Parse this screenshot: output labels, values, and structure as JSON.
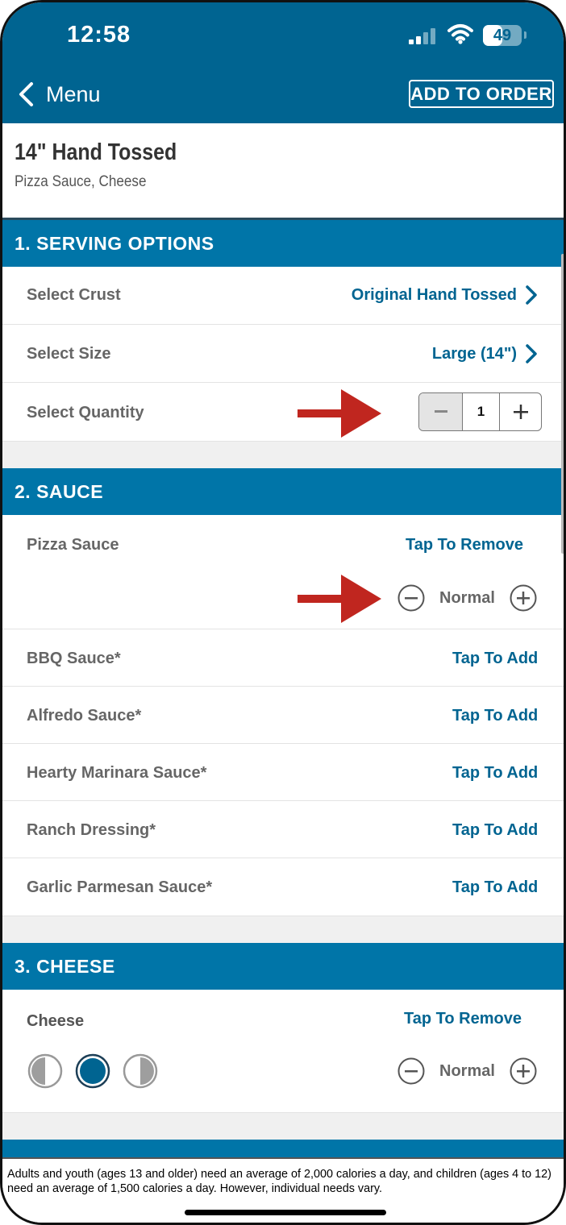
{
  "status_bar": {
    "time": "12:58",
    "battery": "49",
    "battery_level": 0.49
  },
  "nav": {
    "back_label": "Menu",
    "add_to_order": "ADD TO ORDER"
  },
  "product": {
    "title": "14\" Hand Tossed",
    "subtitle": "Pizza Sauce, Cheese"
  },
  "serving_options": {
    "header": "1. SERVING OPTIONS",
    "crust": {
      "label": "Select Crust",
      "value": "Original Hand Tossed"
    },
    "size": {
      "label": "Select Size",
      "value": "Large (14\")"
    },
    "quantity": {
      "label": "Select Quantity",
      "value": "1"
    }
  },
  "sauce": {
    "header": "2. SAUCE",
    "selected": {
      "name": "Pizza Sauce",
      "action": "Tap To Remove",
      "amount": "Normal"
    },
    "options": [
      {
        "name": "BBQ Sauce*",
        "action": "Tap To Add"
      },
      {
        "name": "Alfredo Sauce*",
        "action": "Tap To Add"
      },
      {
        "name": "Hearty Marinara Sauce*",
        "action": "Tap To Add"
      },
      {
        "name": "Ranch Dressing*",
        "action": "Tap To Add"
      },
      {
        "name": "Garlic Parmesan Sauce*",
        "action": "Tap To Add"
      }
    ]
  },
  "cheese": {
    "header": "3. CHEESE",
    "selected": {
      "name": "Cheese",
      "action": "Tap To Remove",
      "amount": "Normal",
      "portion": "whole"
    }
  },
  "footer": {
    "disclaimer": "Adults and youth (ages 13 and older) need an average of 2,000 calories a day, and children (ages 4 to 12) need an average of 1,500 calories a day. However, individual needs vary."
  },
  "colors": {
    "brand_blue": "#006491",
    "section_blue": "#0075a8",
    "annotation_arrow": "#c0261f"
  }
}
